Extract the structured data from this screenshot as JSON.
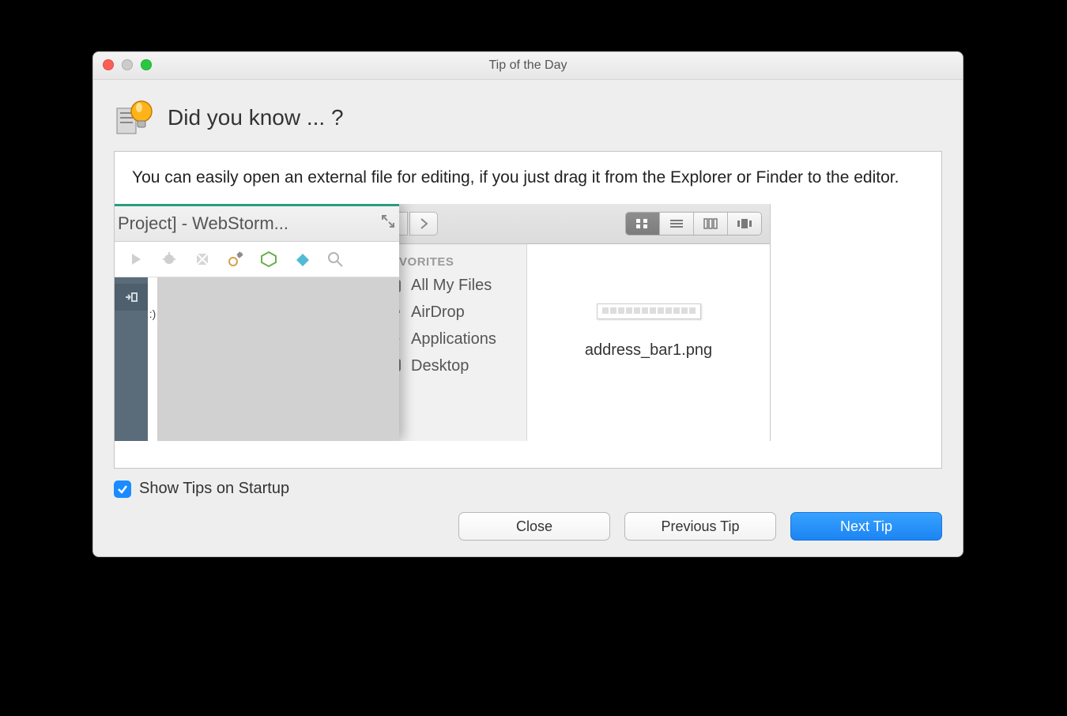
{
  "window": {
    "title": "Tip of the Day"
  },
  "heading": "Did you know ... ?",
  "tip_text": "You can easily open an external file for editing, if you just drag it from the Explorer or Finder to the editor.",
  "illustration": {
    "webstorm_title": "Project] - WebStorm...",
    "finder": {
      "sidebar_header": "FAVORITES",
      "items": [
        {
          "icon": "all-my-files-icon",
          "label": "All My Files"
        },
        {
          "icon": "airdrop-icon",
          "label": "AirDrop"
        },
        {
          "icon": "applications-icon",
          "label": "Applications"
        },
        {
          "icon": "desktop-icon",
          "label": "Desktop"
        }
      ],
      "file_label": "address_bar1.png"
    }
  },
  "footer": {
    "show_tips_label": "Show Tips on Startup",
    "show_tips_checked": true,
    "close_label": "Close",
    "prev_label": "Previous Tip",
    "next_label": "Next Tip"
  }
}
